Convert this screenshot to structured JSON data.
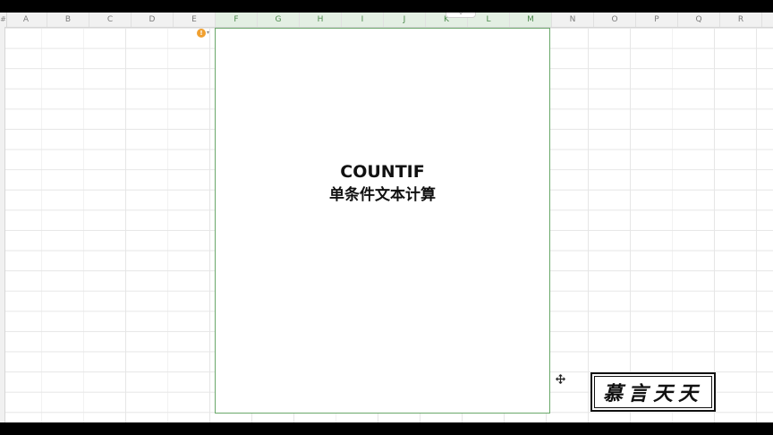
{
  "spreadsheet": {
    "corner_label": "#",
    "columns": [
      "A",
      "B",
      "C",
      "D",
      "E",
      "F",
      "G",
      "H",
      "I",
      "J",
      "K",
      "L",
      "M",
      "N",
      "O",
      "P",
      "Q",
      "R"
    ],
    "selected_columns": [
      "F",
      "G",
      "H",
      "I",
      "J",
      "K",
      "L",
      "M"
    ],
    "tab_notch_label": "⌄"
  },
  "warning": {
    "icon_label": "!"
  },
  "text_box": {
    "line1": "COUNTIF",
    "line2": "单条件文本计算"
  },
  "watermark": {
    "text": "慕言天天"
  },
  "icons": {
    "warning": "warning-icon",
    "cursor": "move-cursor-icon"
  },
  "colors": {
    "selection_border": "#6aa86a",
    "warning": "#f0a030"
  }
}
